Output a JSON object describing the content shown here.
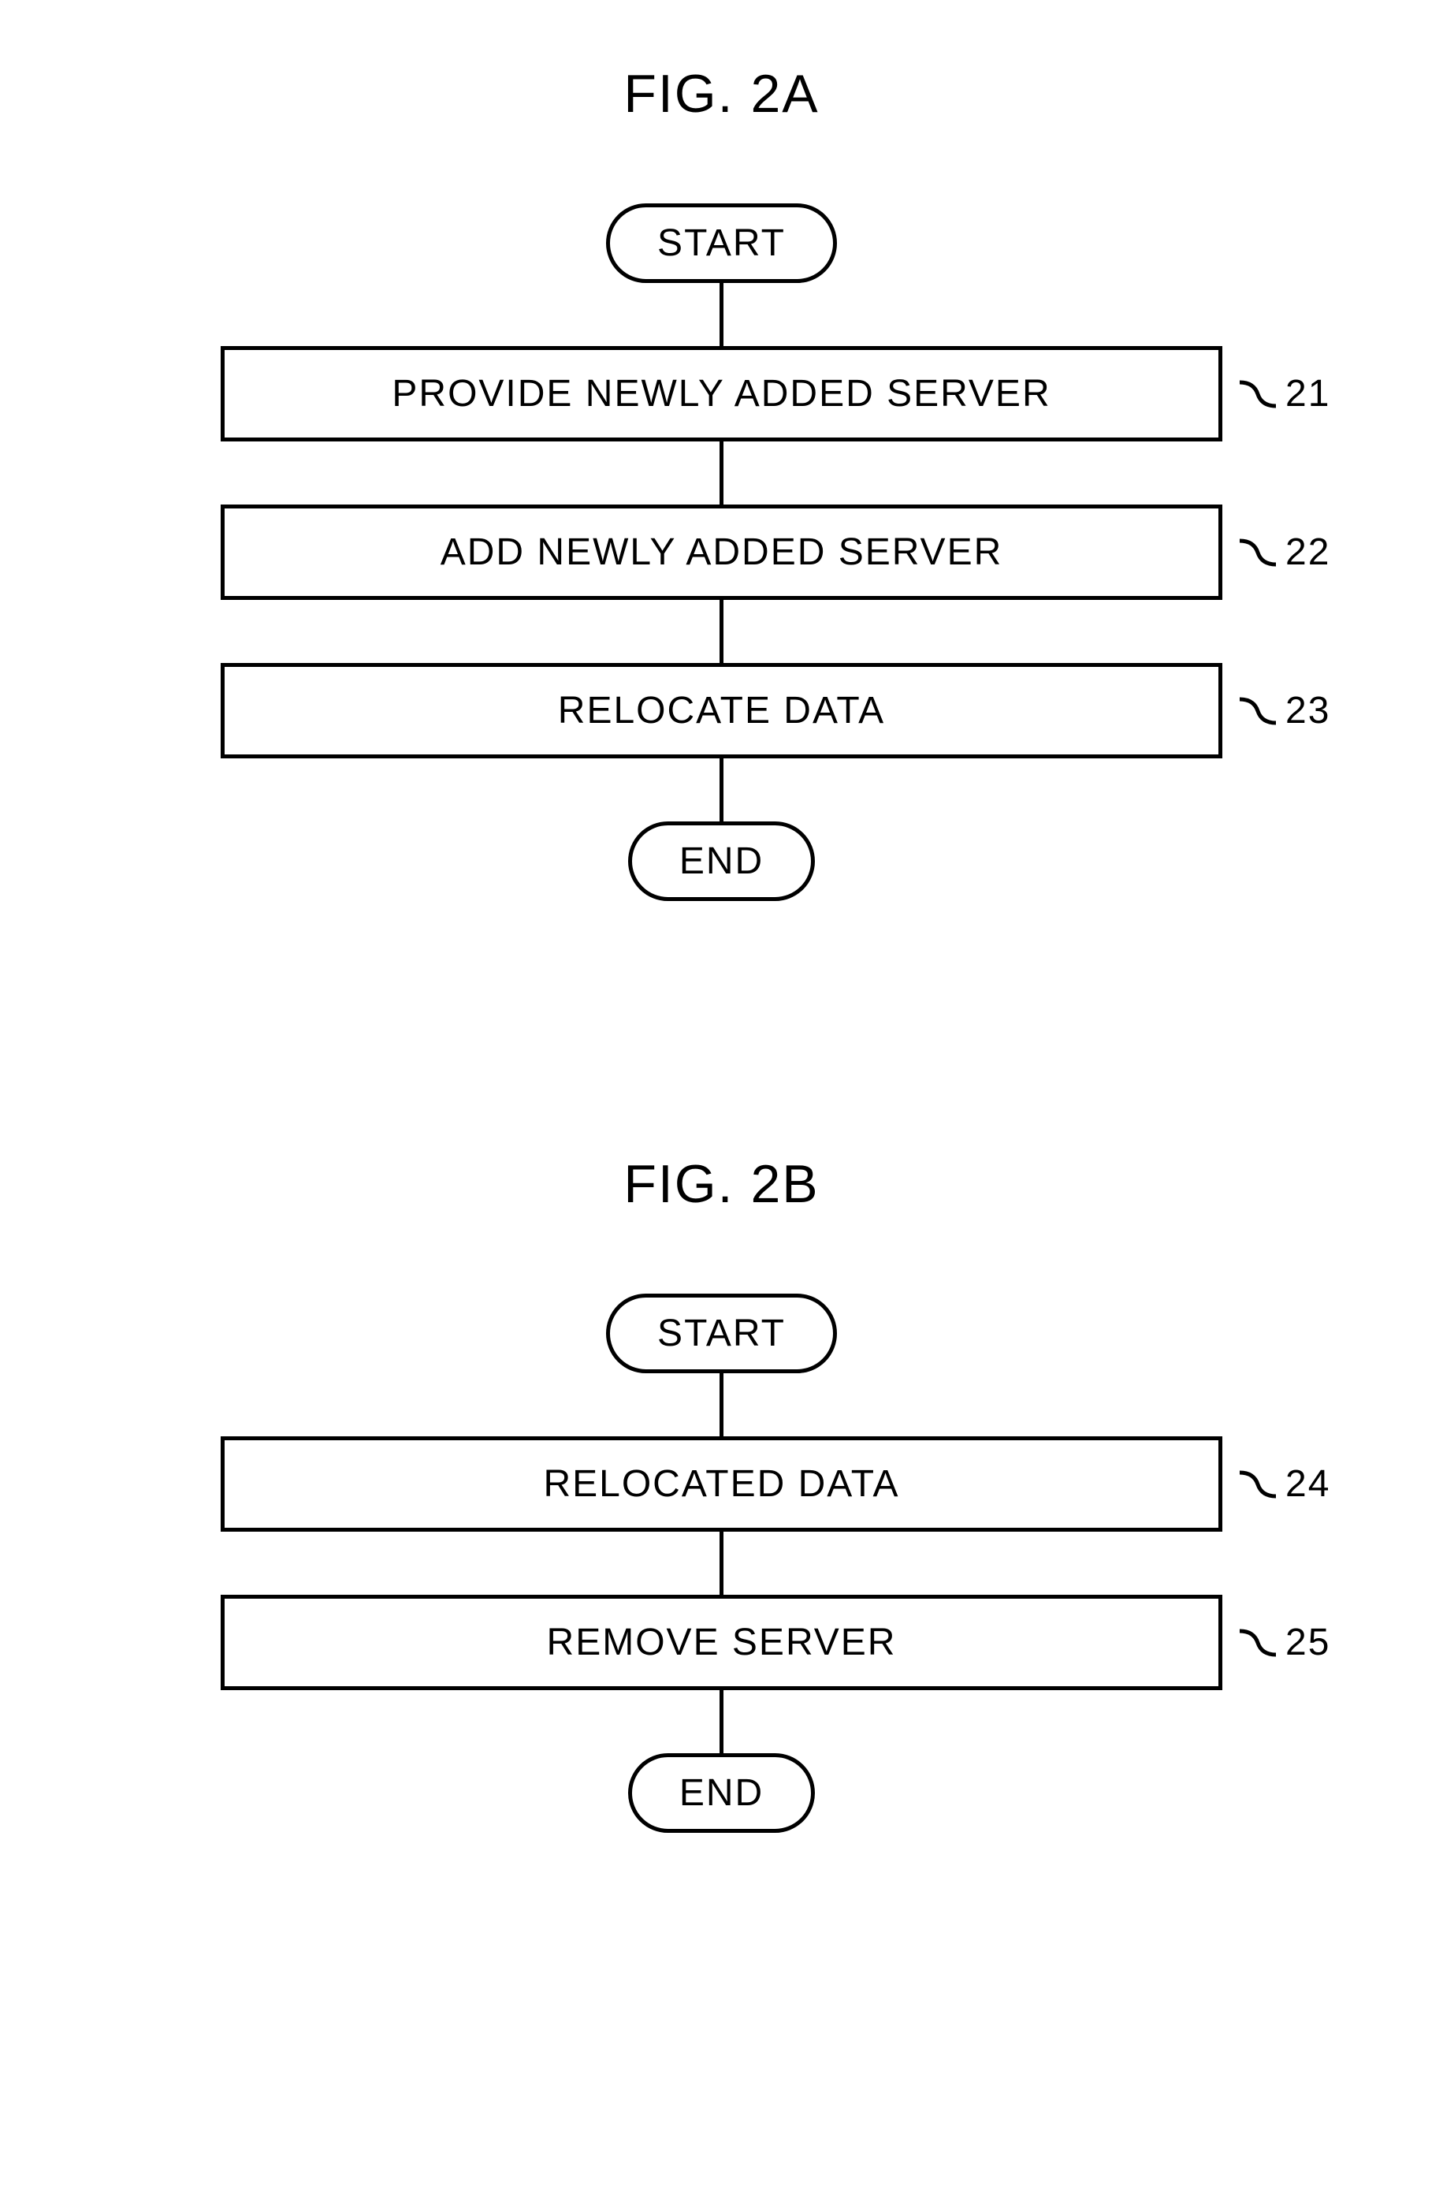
{
  "figA": {
    "title": "FIG. 2A",
    "start": "START",
    "end": "END",
    "steps": [
      {
        "text": "PROVIDE NEWLY ADDED SERVER",
        "label": "21"
      },
      {
        "text": "ADD NEWLY ADDED SERVER",
        "label": "22"
      },
      {
        "text": "RELOCATE DATA",
        "label": "23"
      }
    ]
  },
  "figB": {
    "title": "FIG. 2B",
    "start": "START",
    "end": "END",
    "steps": [
      {
        "text": "RELOCATED DATA",
        "label": "24"
      },
      {
        "text": "REMOVE SERVER",
        "label": "25"
      }
    ]
  }
}
